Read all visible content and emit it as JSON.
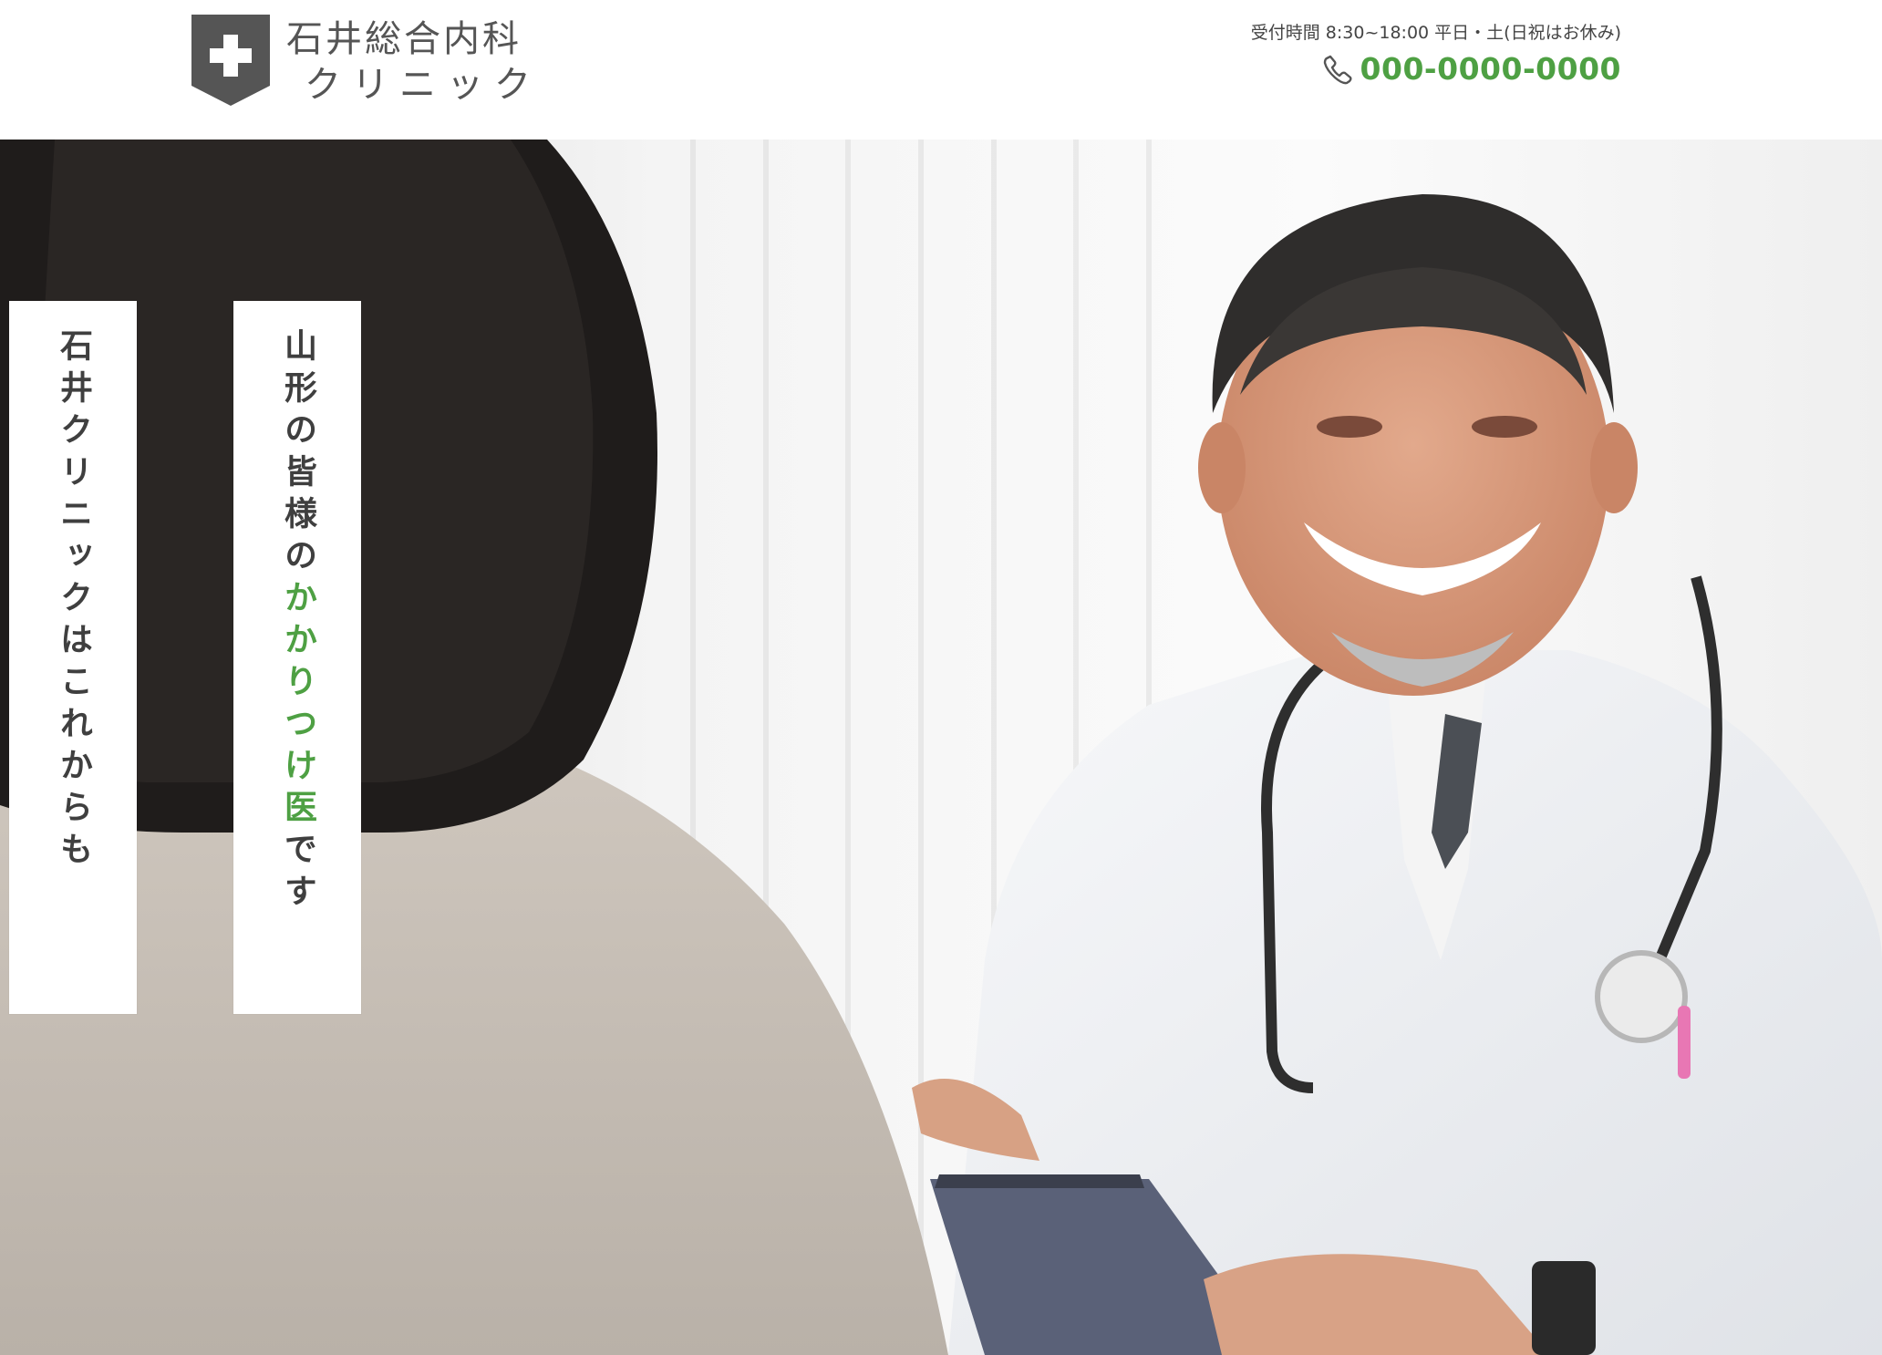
{
  "header": {
    "logo_line1": "石井総合内科",
    "logo_line2": "クリニック",
    "hours": "受付時間 8:30~18:00 平日・土(日祝はお休み)",
    "phone": "000-0000-0000"
  },
  "hero": {
    "tagline_1": "石井クリニックはこれからも",
    "tagline_2_pre": "山形の皆様の",
    "tagline_2_accent": "かかりつけ医",
    "tagline_2_post": "です"
  },
  "colors": {
    "accent": "#4ea043",
    "logo_gray": "#555555",
    "text": "#333333"
  },
  "icons": {
    "logo": "cross-shield-icon",
    "phone": "phone-icon"
  }
}
